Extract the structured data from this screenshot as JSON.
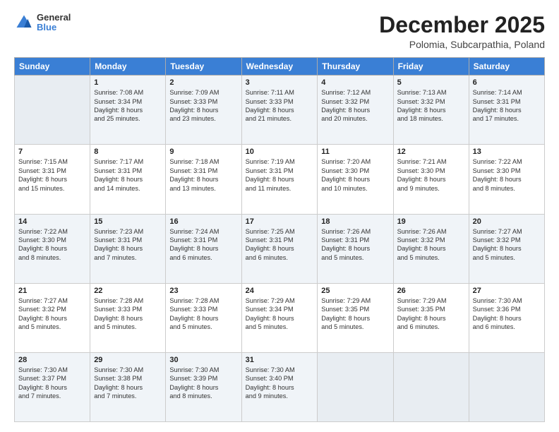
{
  "logo": {
    "general": "General",
    "blue": "Blue"
  },
  "header": {
    "month": "December 2025",
    "location": "Polomia, Subcarpathia, Poland"
  },
  "days": [
    "Sunday",
    "Monday",
    "Tuesday",
    "Wednesday",
    "Thursday",
    "Friday",
    "Saturday"
  ],
  "weeks": [
    [
      {
        "day": "",
        "content": ""
      },
      {
        "day": "1",
        "content": "Sunrise: 7:08 AM\nSunset: 3:34 PM\nDaylight: 8 hours\nand 25 minutes."
      },
      {
        "day": "2",
        "content": "Sunrise: 7:09 AM\nSunset: 3:33 PM\nDaylight: 8 hours\nand 23 minutes."
      },
      {
        "day": "3",
        "content": "Sunrise: 7:11 AM\nSunset: 3:33 PM\nDaylight: 8 hours\nand 21 minutes."
      },
      {
        "day": "4",
        "content": "Sunrise: 7:12 AM\nSunset: 3:32 PM\nDaylight: 8 hours\nand 20 minutes."
      },
      {
        "day": "5",
        "content": "Sunrise: 7:13 AM\nSunset: 3:32 PM\nDaylight: 8 hours\nand 18 minutes."
      },
      {
        "day": "6",
        "content": "Sunrise: 7:14 AM\nSunset: 3:31 PM\nDaylight: 8 hours\nand 17 minutes."
      }
    ],
    [
      {
        "day": "7",
        "content": "Sunrise: 7:15 AM\nSunset: 3:31 PM\nDaylight: 8 hours\nand 15 minutes."
      },
      {
        "day": "8",
        "content": "Sunrise: 7:17 AM\nSunset: 3:31 PM\nDaylight: 8 hours\nand 14 minutes."
      },
      {
        "day": "9",
        "content": "Sunrise: 7:18 AM\nSunset: 3:31 PM\nDaylight: 8 hours\nand 13 minutes."
      },
      {
        "day": "10",
        "content": "Sunrise: 7:19 AM\nSunset: 3:31 PM\nDaylight: 8 hours\nand 11 minutes."
      },
      {
        "day": "11",
        "content": "Sunrise: 7:20 AM\nSunset: 3:30 PM\nDaylight: 8 hours\nand 10 minutes."
      },
      {
        "day": "12",
        "content": "Sunrise: 7:21 AM\nSunset: 3:30 PM\nDaylight: 8 hours\nand 9 minutes."
      },
      {
        "day": "13",
        "content": "Sunrise: 7:22 AM\nSunset: 3:30 PM\nDaylight: 8 hours\nand 8 minutes."
      }
    ],
    [
      {
        "day": "14",
        "content": "Sunrise: 7:22 AM\nSunset: 3:30 PM\nDaylight: 8 hours\nand 8 minutes."
      },
      {
        "day": "15",
        "content": "Sunrise: 7:23 AM\nSunset: 3:31 PM\nDaylight: 8 hours\nand 7 minutes."
      },
      {
        "day": "16",
        "content": "Sunrise: 7:24 AM\nSunset: 3:31 PM\nDaylight: 8 hours\nand 6 minutes."
      },
      {
        "day": "17",
        "content": "Sunrise: 7:25 AM\nSunset: 3:31 PM\nDaylight: 8 hours\nand 6 minutes."
      },
      {
        "day": "18",
        "content": "Sunrise: 7:26 AM\nSunset: 3:31 PM\nDaylight: 8 hours\nand 5 minutes."
      },
      {
        "day": "19",
        "content": "Sunrise: 7:26 AM\nSunset: 3:32 PM\nDaylight: 8 hours\nand 5 minutes."
      },
      {
        "day": "20",
        "content": "Sunrise: 7:27 AM\nSunset: 3:32 PM\nDaylight: 8 hours\nand 5 minutes."
      }
    ],
    [
      {
        "day": "21",
        "content": "Sunrise: 7:27 AM\nSunset: 3:32 PM\nDaylight: 8 hours\nand 5 minutes."
      },
      {
        "day": "22",
        "content": "Sunrise: 7:28 AM\nSunset: 3:33 PM\nDaylight: 8 hours\nand 5 minutes."
      },
      {
        "day": "23",
        "content": "Sunrise: 7:28 AM\nSunset: 3:33 PM\nDaylight: 8 hours\nand 5 minutes."
      },
      {
        "day": "24",
        "content": "Sunrise: 7:29 AM\nSunset: 3:34 PM\nDaylight: 8 hours\nand 5 minutes."
      },
      {
        "day": "25",
        "content": "Sunrise: 7:29 AM\nSunset: 3:35 PM\nDaylight: 8 hours\nand 5 minutes."
      },
      {
        "day": "26",
        "content": "Sunrise: 7:29 AM\nSunset: 3:35 PM\nDaylight: 8 hours\nand 6 minutes."
      },
      {
        "day": "27",
        "content": "Sunrise: 7:30 AM\nSunset: 3:36 PM\nDaylight: 8 hours\nand 6 minutes."
      }
    ],
    [
      {
        "day": "28",
        "content": "Sunrise: 7:30 AM\nSunset: 3:37 PM\nDaylight: 8 hours\nand 7 minutes."
      },
      {
        "day": "29",
        "content": "Sunrise: 7:30 AM\nSunset: 3:38 PM\nDaylight: 8 hours\nand 7 minutes."
      },
      {
        "day": "30",
        "content": "Sunrise: 7:30 AM\nSunset: 3:39 PM\nDaylight: 8 hours\nand 8 minutes."
      },
      {
        "day": "31",
        "content": "Sunrise: 7:30 AM\nSunset: 3:40 PM\nDaylight: 8 hours\nand 9 minutes."
      },
      {
        "day": "",
        "content": ""
      },
      {
        "day": "",
        "content": ""
      },
      {
        "day": "",
        "content": ""
      }
    ]
  ]
}
